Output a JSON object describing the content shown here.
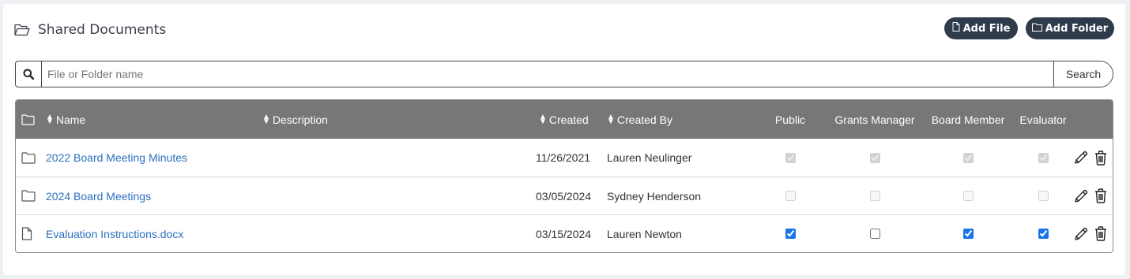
{
  "header": {
    "title": "Shared Documents",
    "add_file_label": "Add File",
    "add_folder_label": "Add Folder"
  },
  "search": {
    "placeholder": "File or Folder name",
    "value": "",
    "button_label": "Search"
  },
  "table": {
    "columns": {
      "name": "Name",
      "description": "Description",
      "created": "Created",
      "created_by": "Created By",
      "public": "Public",
      "grants_manager": "Grants Manager",
      "board_member": "Board Member",
      "evaluator": "Evaluator"
    },
    "rows": [
      {
        "type": "folder",
        "icon": "folder-icon",
        "name": "2022 Board Meeting Minutes",
        "description": "",
        "created": "11/26/2021",
        "created_by": "Lauren Neulinger",
        "public": true,
        "grants_manager": true,
        "board_member": true,
        "evaluator": true,
        "permissions_disabled": true
      },
      {
        "type": "folder",
        "icon": "folder-icon",
        "name": "2024 Board Meetings",
        "description": "",
        "created": "03/05/2024",
        "created_by": "Sydney Henderson",
        "public": false,
        "grants_manager": false,
        "board_member": false,
        "evaluator": false,
        "permissions_disabled": true
      },
      {
        "type": "file",
        "icon": "file-icon",
        "name": "Evaluation Instructions.docx",
        "description": "",
        "created": "03/15/2024",
        "created_by": "Lauren Newton",
        "public": true,
        "grants_manager": false,
        "board_member": true,
        "evaluator": true,
        "permissions_disabled": false
      }
    ]
  },
  "colors": {
    "header_bg": "#777777",
    "button_bg": "#2f3b4b",
    "link": "#2a6fbf",
    "checkbox_accent": "#1a73e8"
  }
}
